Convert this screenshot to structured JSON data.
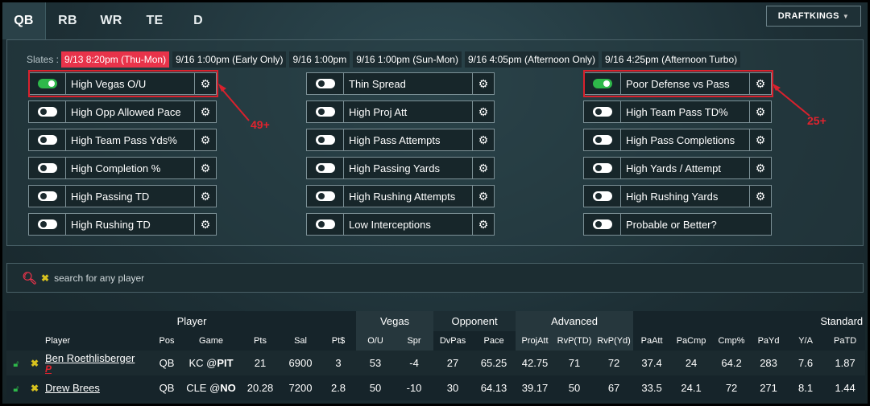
{
  "tabs": [
    "QB",
    "RB",
    "WR",
    "TE",
    "D"
  ],
  "brand_button": "DRAFTKINGS",
  "slates_label": "Slates :",
  "slates": [
    "9/13 8:20pm (Thu-Mon)",
    "9/16 1:00pm (Early Only)",
    "9/16 1:00pm",
    "9/16 1:00pm (Sun-Mon)",
    "9/16 4:05pm (Afternoon Only)",
    "9/16 4:25pm (Afternoon Turbo)"
  ],
  "filters": {
    "col1": [
      {
        "label": "High Vegas O/U",
        "on": true
      },
      {
        "label": "High Opp Allowed Pace",
        "on": false
      },
      {
        "label": "High Team Pass Yds%",
        "on": false
      },
      {
        "label": "High Completion %",
        "on": false
      },
      {
        "label": "High Passing TD",
        "on": false
      },
      {
        "label": "High Rushing TD",
        "on": false
      }
    ],
    "col2": [
      {
        "label": "Thin Spread",
        "on": false
      },
      {
        "label": "High Proj Att",
        "on": false
      },
      {
        "label": "High Pass Attempts",
        "on": false
      },
      {
        "label": "High Passing Yards",
        "on": false
      },
      {
        "label": "High Rushing Attempts",
        "on": false
      },
      {
        "label": "Low Interceptions",
        "on": false
      }
    ],
    "col3": [
      {
        "label": "Poor Defense vs Pass",
        "on": true
      },
      {
        "label": "High Team Pass TD%",
        "on": false
      },
      {
        "label": "High Pass Completions",
        "on": false
      },
      {
        "label": "High Yards / Attempt",
        "on": false
      },
      {
        "label": "High Rushing Yards",
        "on": false
      },
      {
        "label": "Probable or Better?",
        "on": false
      }
    ]
  },
  "annotations": [
    "49+",
    "25+"
  ],
  "search": {
    "placeholder": "search for any player"
  },
  "table": {
    "groups": {
      "player": "Player",
      "vegas": "Vegas",
      "opponent": "Opponent",
      "advanced": "Advanced",
      "standard": "Standard"
    },
    "columns": [
      "Player",
      "Pos",
      "Game",
      "Pts",
      "Sal",
      "Pt$",
      "O/U",
      "Spr",
      "DvPas",
      "Pace",
      "ProjAtt",
      "RvP(TD)",
      "RvP(Yd)",
      "PaAtt",
      "PaCmp",
      "Cmp%",
      "PaYd",
      "Y/A",
      "PaTD"
    ],
    "rows": [
      {
        "name": "Ben Roethlisberger",
        "flag": "P",
        "pos": "QB",
        "game_opp": "KC @",
        "game_team": "PIT",
        "pts": "21",
        "sal": "6900",
        "ptd": "3",
        "ou": "53",
        "spr": "-4",
        "dvpas": "27",
        "pace": "65.25",
        "projatt": "42.75",
        "rvptd": "71",
        "rvpyd": "72",
        "paatt": "37.4",
        "pacmp": "24",
        "cmp": "64.2",
        "payd": "283",
        "ya": "7.6",
        "patd": "1.87"
      },
      {
        "name": "Drew Brees",
        "flag": "",
        "pos": "QB",
        "game_opp": "CLE @",
        "game_team": "NO",
        "pts": "20.28",
        "sal": "7200",
        "ptd": "2.8",
        "ou": "50",
        "spr": "-10",
        "dvpas": "30",
        "pace": "64.13",
        "projatt": "39.17",
        "rvptd": "50",
        "rvpyd": "67",
        "paatt": "33.5",
        "pacmp": "24.1",
        "cmp": "72",
        "payd": "271",
        "ya": "8.1",
        "patd": "1.44"
      }
    ]
  }
}
